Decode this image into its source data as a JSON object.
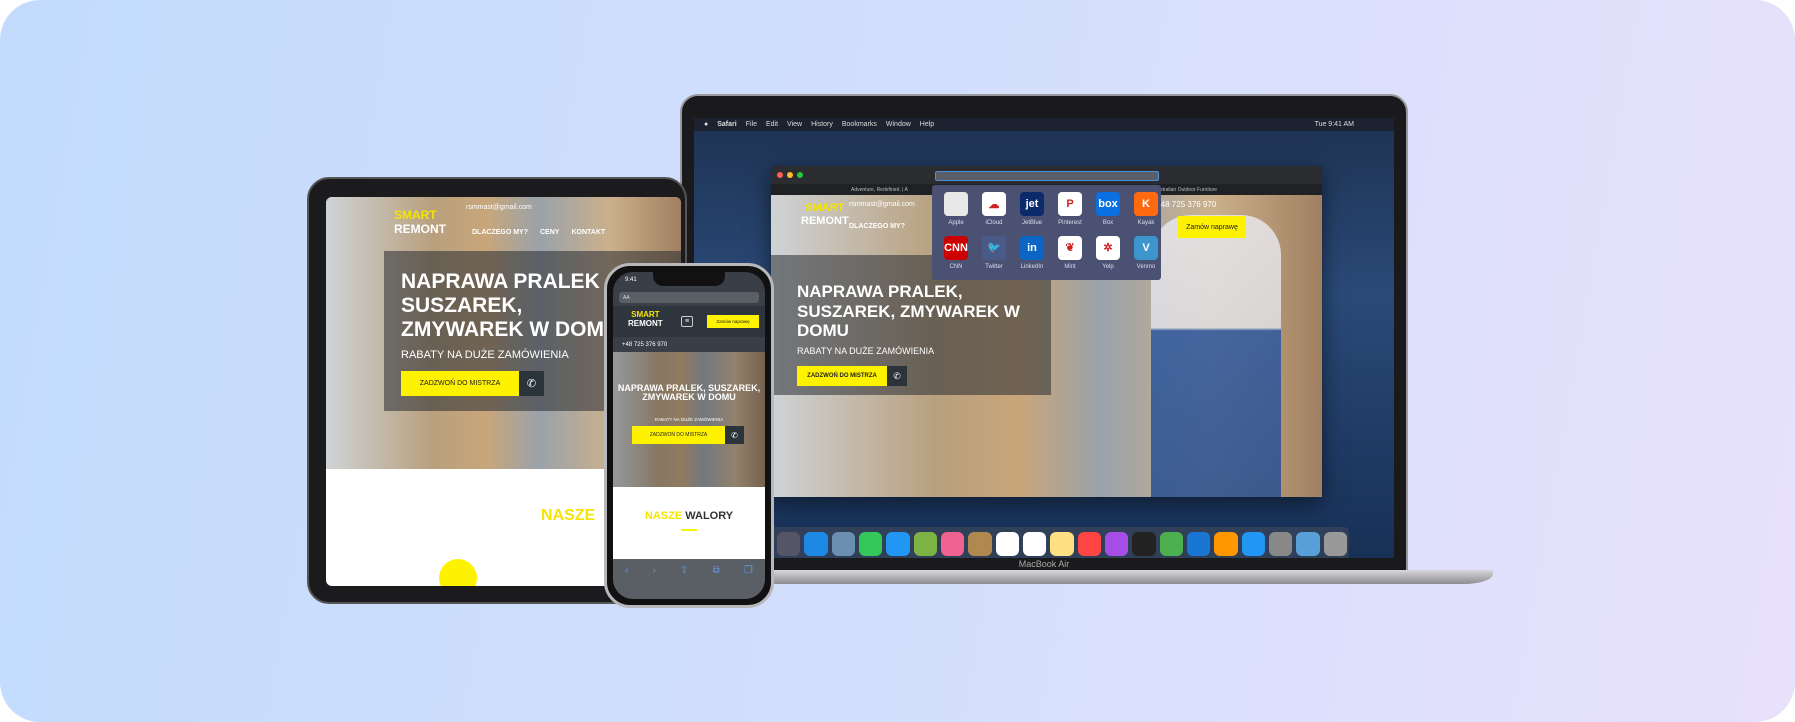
{
  "site": {
    "brand_top": "SMART",
    "brand_bottom": "REMONT",
    "email": "rsmmast@gmail.com",
    "nav": [
      "DLACZEGO MY?",
      "CENY",
      "KONTAKT"
    ],
    "hero_title_laptop": "NAPRAWA PRALEK, SUSZAREK, ZMYWAREK W DOMU",
    "hero_title_tablet": "NAPRAWA PRALEK SUSZAREK, ZMYWAREK W DOMU",
    "subtitle": "RABATY NA DUŻE ZAMÓWIENIA",
    "cta": "ZADZWOŃ DO MISTRZA",
    "order": "Zamów naprawę",
    "phone": "+48 725 376 970",
    "section_a": "NASZE",
    "section_b": "WALORY"
  },
  "mac": {
    "menu": [
      "Safari",
      "File",
      "Edit",
      "View",
      "History",
      "Bookmarks",
      "Window",
      "Help"
    ],
    "clock": "Tue 9:41 AM",
    "tabs": [
      "Adventure, Redefined. | A",
      "Tait | Premium Australian Outdoor Furniture"
    ],
    "favorites": [
      {
        "label": "Apple",
        "color": "#e8e8e8",
        "glyph": ""
      },
      {
        "label": "iCloud",
        "color": "#ffffff",
        "glyph": "☁"
      },
      {
        "label": "JetBlue",
        "color": "#0b2a6b",
        "glyph": "jet"
      },
      {
        "label": "Pinterest",
        "color": "#ffffff",
        "glyph": "P"
      },
      {
        "label": "Box",
        "color": "#0a6fe0",
        "glyph": "box"
      },
      {
        "label": "Kayak",
        "color": "#ff690f",
        "glyph": "K"
      },
      {
        "label": "CNN",
        "color": "#cc0000",
        "glyph": "CNN"
      },
      {
        "label": "Twitter",
        "color": "#4a5a88",
        "glyph": "🐦"
      },
      {
        "label": "LinkedIn",
        "color": "#0a66c2",
        "glyph": "in"
      },
      {
        "label": "Mint",
        "color": "#ffffff",
        "glyph": "❦"
      },
      {
        "label": "Yelp",
        "color": "#ffffff",
        "glyph": "✲"
      },
      {
        "label": "Venmo",
        "color": "#3d95ce",
        "glyph": "V"
      }
    ],
    "model": "MacBook Air"
  },
  "phone": {
    "time": "9:41",
    "address": "AA"
  },
  "dock_colors": [
    "#556",
    "#1e88e5",
    "#6a8fb0",
    "#34c759",
    "#2196f3",
    "#7cb342",
    "#f06292",
    "#b08850",
    "#fff",
    "#fff",
    "#ffe082",
    "#f44",
    "#a64de6",
    "#222",
    "#4caf50",
    "#1976d2",
    "#ff9800",
    "#2196f3",
    "#888",
    "#5aa0d8",
    "#999"
  ],
  "colors": {
    "accent": "#fff200",
    "dark": "#2b333b"
  }
}
